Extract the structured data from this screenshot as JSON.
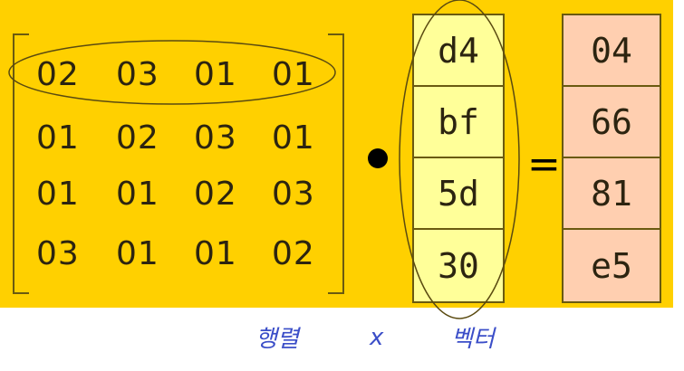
{
  "matrix": [
    [
      "02",
      "03",
      "01",
      "01"
    ],
    [
      "01",
      "02",
      "03",
      "01"
    ],
    [
      "01",
      "01",
      "02",
      "03"
    ],
    [
      "03",
      "01",
      "01",
      "02"
    ]
  ],
  "operator_dot": "•",
  "vector": [
    "d4",
    "bf",
    "5d",
    "30"
  ],
  "equals": "=",
  "result": [
    "04",
    "66",
    "81",
    "e5"
  ],
  "handwriting": {
    "left": "행렬",
    "middle": "x",
    "right": "벡터"
  },
  "colors": {
    "background": "#ffd000",
    "vector_fill": "#ffff99",
    "result_fill": "#ffcfb0",
    "annotation_ink": "#3b4ec8"
  }
}
